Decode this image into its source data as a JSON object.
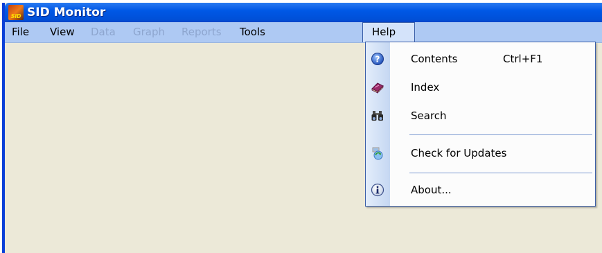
{
  "app": {
    "title": "SID Monitor",
    "icon_text": "SID",
    "icon": "sid-app-icon"
  },
  "menubar": {
    "items": [
      {
        "label": "File",
        "enabled": true
      },
      {
        "label": "View",
        "enabled": true
      },
      {
        "label": "Data",
        "enabled": false
      },
      {
        "label": "Graph",
        "enabled": false
      },
      {
        "label": "Reports",
        "enabled": false
      },
      {
        "label": "Tools",
        "enabled": true
      },
      {
        "label": "Help",
        "enabled": true,
        "open": true
      }
    ]
  },
  "help_menu": {
    "items": [
      {
        "label": "Contents",
        "shortcut": "Ctrl+F1",
        "icon": "help-question-icon"
      },
      {
        "label": "Index",
        "icon": "book-icon"
      },
      {
        "label": "Search",
        "icon": "binoculars-icon"
      },
      {
        "label": "Check for Updates",
        "icon": "update-icon"
      },
      {
        "label": "About...",
        "icon": "info-icon"
      }
    ]
  },
  "colors": {
    "titlebar": "#0058e6",
    "menubar": "#aec9f3",
    "client_area": "#ece9d8",
    "disabled_text": "#8ea6cf",
    "menu_border": "#3b5fa8"
  }
}
